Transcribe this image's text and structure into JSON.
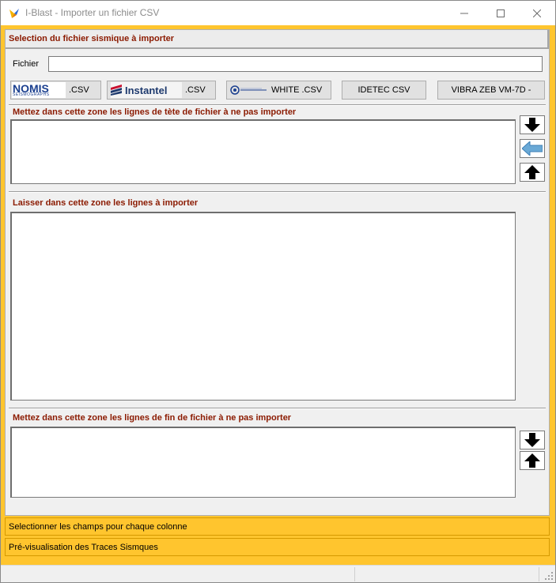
{
  "window": {
    "title": "I-Blast - Importer un fichier CSV",
    "minimize_icon": "minimize-icon",
    "maximize_icon": "maximize-icon",
    "close_icon": "close-icon"
  },
  "panel": {
    "header": "Selection du fichier sismique à importer",
    "fichier_label": "Fichier",
    "fichier_value": "",
    "buttons": {
      "nomis_logo_big": "NOMIS",
      "nomis_logo_small": "SEISMOGRAPHS",
      "nomis_suffix": ".CSV",
      "instantel_logo": "Instantel",
      "instantel_suffix": ".CSV",
      "white_suffix": "WHITE .CSV",
      "idetec": "IDETEC CSV",
      "vibra": "VIBRA ZEB VM-7D -"
    },
    "section_header_lines": "Mettez dans cette zone les lignes de tète de fichier à ne pas importer",
    "section_import_lines": "Laisser dans cette zone les lignes  à  importer",
    "section_footer_lines": "Mettez dans cette zone les lignes de fin de fichier à ne pas importer",
    "header_textarea_value": "",
    "import_textarea_value": "",
    "footer_textarea_value": ""
  },
  "bars": {
    "select_fields": "Selectionner les champs pour chaque colonne",
    "preview": "Pré-visualisation des Traces Sismques"
  },
  "colors": {
    "frame": "#ffc52e",
    "section_label": "#8b1a00",
    "panel_bg": "#f0f0f0"
  }
}
